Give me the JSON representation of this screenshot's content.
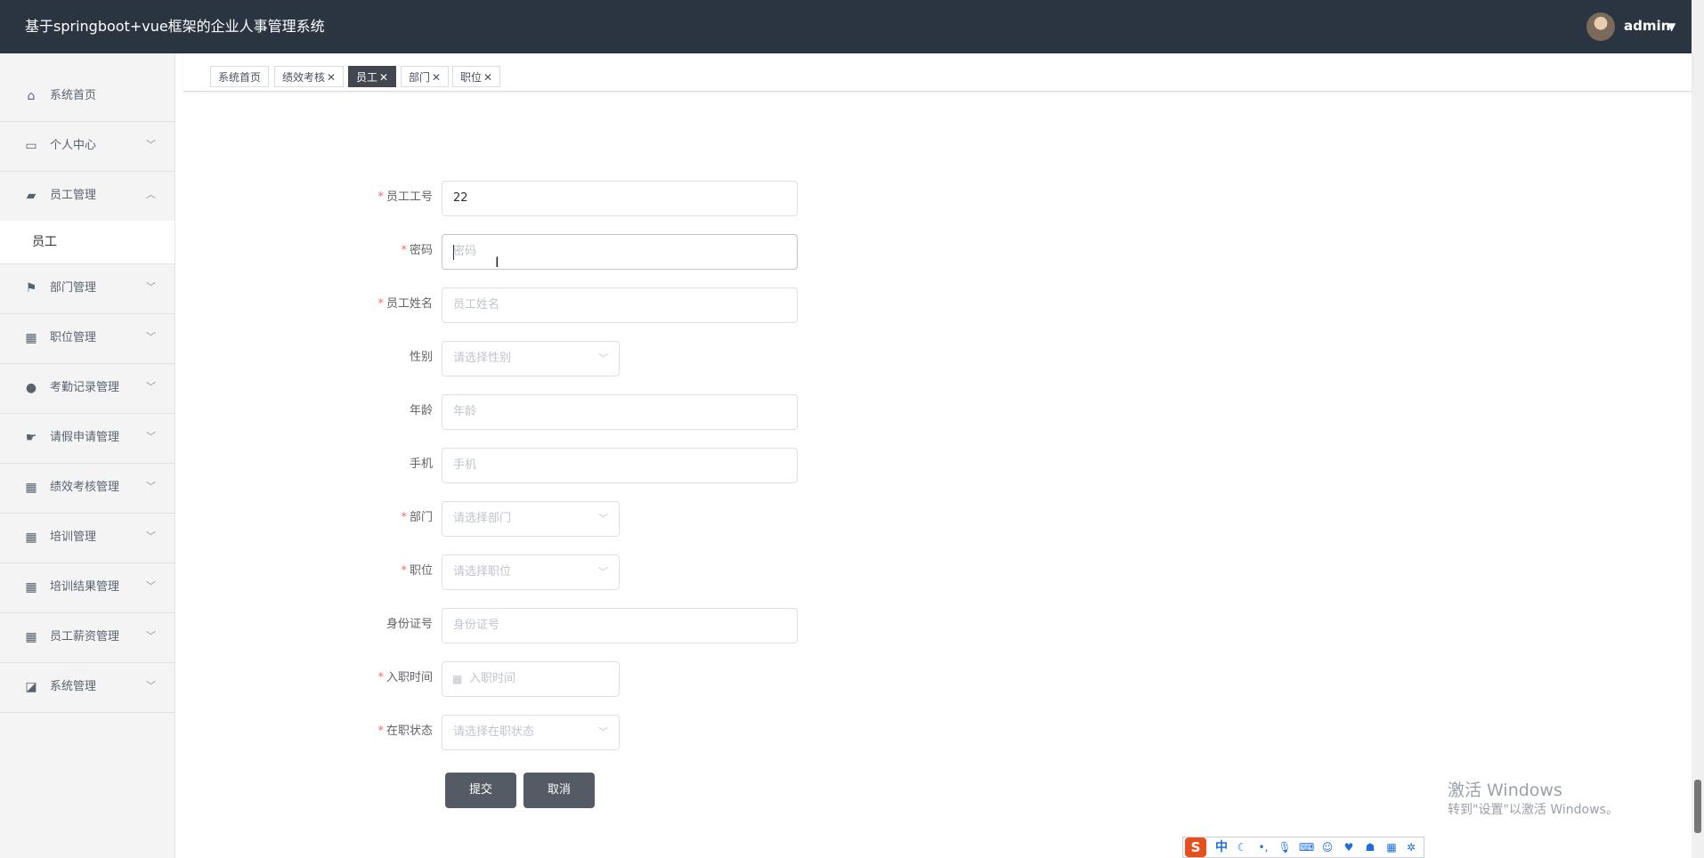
{
  "header": {
    "title": "基于springboot+vue框架的企业人事管理系统",
    "user": "admin"
  },
  "sidebar": {
    "items": [
      {
        "label": "系统首页",
        "icon": "home-icon"
      },
      {
        "label": "个人中心",
        "icon": "card-icon"
      },
      {
        "label": "员工管理",
        "icon": "ticket-icon",
        "expanded": true
      },
      {
        "label": "部门管理",
        "icon": "flag-icon"
      },
      {
        "label": "职位管理",
        "icon": "grid-icon"
      },
      {
        "label": "考勤记录管理",
        "icon": "user-icon"
      },
      {
        "label": "请假申请管理",
        "icon": "hand-icon"
      },
      {
        "label": "绩效考核管理",
        "icon": "grid-icon"
      },
      {
        "label": "培训管理",
        "icon": "grid-icon"
      },
      {
        "label": "培训结果管理",
        "icon": "grid-icon"
      },
      {
        "label": "员工薪资管理",
        "icon": "grid-icon"
      },
      {
        "label": "系统管理",
        "icon": "chart-icon"
      }
    ],
    "sub_item": "员工"
  },
  "tags": [
    {
      "label": "系统首页",
      "closable": false,
      "active": false
    },
    {
      "label": "绩效考核",
      "closable": true,
      "active": false
    },
    {
      "label": "员工",
      "closable": true,
      "active": true
    },
    {
      "label": "部门",
      "closable": true,
      "active": false
    },
    {
      "label": "职位",
      "closable": true,
      "active": false
    }
  ],
  "form": {
    "fields": [
      {
        "label": "员工工号",
        "required": true,
        "value": "22",
        "placeholder": ""
      },
      {
        "label": "密码",
        "required": true,
        "value": "",
        "placeholder": "密码"
      },
      {
        "label": "员工姓名",
        "required": true,
        "value": "",
        "placeholder": "员工姓名"
      },
      {
        "label": "性别",
        "required": false,
        "value": "",
        "placeholder": "请选择性别"
      },
      {
        "label": "年龄",
        "required": false,
        "value": "",
        "placeholder": "年龄"
      },
      {
        "label": "手机",
        "required": false,
        "value": "",
        "placeholder": "手机"
      },
      {
        "label": "部门",
        "required": true,
        "value": "",
        "placeholder": "请选择部门"
      },
      {
        "label": "职位",
        "required": true,
        "value": "",
        "placeholder": "请选择职位"
      },
      {
        "label": "身份证号",
        "required": false,
        "value": "",
        "placeholder": "身份证号"
      },
      {
        "label": "入职时间",
        "required": true,
        "value": "",
        "placeholder": "入职时间"
      },
      {
        "label": "在职状态",
        "required": true,
        "value": "",
        "placeholder": "请选择在职状态"
      }
    ],
    "submit": "提交",
    "cancel": "取消"
  },
  "watermark": {
    "line1": "激活 Windows",
    "line2": "转到\"设置\"以激活 Windows。"
  },
  "ime": {
    "logo": "S",
    "mode": "中"
  }
}
